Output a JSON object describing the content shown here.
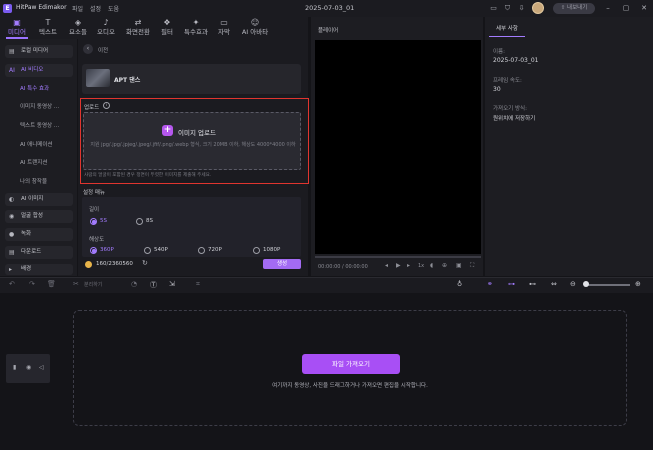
{
  "app": {
    "name": "HitPaw Edimakor",
    "logo": "E"
  },
  "menu": [
    "파일",
    "설정",
    "도움"
  ],
  "document_title": "2025-07-03_01",
  "vip_button": "내보내기",
  "toolbar_tabs": [
    {
      "icon": "media-icon",
      "glyph": "▣",
      "label": "미디어"
    },
    {
      "icon": "text-icon",
      "glyph": "T",
      "label": "텍스트"
    },
    {
      "icon": "elements-icon",
      "glyph": "◈",
      "label": "요소들"
    },
    {
      "icon": "audio-icon",
      "glyph": "♪",
      "label": "오디오"
    },
    {
      "icon": "transition-icon",
      "glyph": "⇄",
      "label": "화면전환"
    },
    {
      "icon": "filter-icon",
      "glyph": "❖",
      "label": "필터"
    },
    {
      "icon": "effects-icon",
      "glyph": "✦",
      "label": "특수효과"
    },
    {
      "icon": "subtitle-icon",
      "glyph": "▭",
      "label": "자막"
    },
    {
      "icon": "avatar-icon",
      "glyph": "☺",
      "label": "AI 아바타"
    }
  ],
  "sidebar": {
    "items": [
      {
        "label": "로컬 미디어",
        "glyph": "▤"
      },
      {
        "label": "AI 비디오",
        "glyph": "AI",
        "active": true
      },
      {
        "label": "AI 이미지",
        "glyph": "◐"
      },
      {
        "label": "얼굴 합성",
        "glyph": "◉"
      },
      {
        "label": "녹화",
        "glyph": "●"
      },
      {
        "label": "다운로드",
        "glyph": "▤"
      },
      {
        "label": "배경",
        "glyph": "▸"
      }
    ],
    "subitems": [
      {
        "label": "AI 특수 효과",
        "active": true
      },
      {
        "label": "이미지 동영상 ..."
      },
      {
        "label": "텍스트 동영상 ..."
      },
      {
        "label": "AI 애니메이션"
      },
      {
        "label": "AI 트랜지션"
      },
      {
        "label": "나의 창작물"
      }
    ]
  },
  "panel": {
    "back_label": "이전",
    "style_name": "APT 댄스",
    "upload_label": "업로드",
    "upload_button": "이미지 업로드",
    "upload_hint": "지원 jpg/.jpg/.jpjeg/.jpeg/.jfif/.png/.webp 형식, 크기 20MB 이하, 해상도 4000*4000 이하",
    "upload_note": "사람의 얼굴이 포함된 경우 정면이 뚜렷한 이미지를 제출해 주세요.",
    "settings_title": "설정 매뉴",
    "length_label": "길이",
    "length_options": [
      {
        "label": "5S",
        "selected": true
      },
      {
        "label": "8S",
        "selected": false
      }
    ],
    "resolution_label": "해상도",
    "resolution_options": [
      {
        "label": "360P",
        "selected": true
      },
      {
        "label": "540P",
        "selected": false
      },
      {
        "label": "720P",
        "selected": false
      },
      {
        "label": "1080P",
        "selected": false
      }
    ],
    "credits": "160/2360560",
    "generate_button": "생성"
  },
  "player": {
    "title": "플레이어",
    "time": "00:00:00 / 00:00:00",
    "speed": "1x",
    "progress": 0
  },
  "details": {
    "tab": "세부 사항",
    "fields": [
      {
        "label": "이름:",
        "value": "2025-07-03_01"
      },
      {
        "label": "프레임 속도:",
        "value": "30"
      },
      {
        "label": "가져오기 방식:",
        "value": "원위치에 저장하기"
      }
    ]
  },
  "timeline": {
    "import_button": "파일 가져오기",
    "hint": "여기까지 동영상, 사진을 드래그하거나 가져오면 편집을 시작합니다.",
    "split_label": "분리하기"
  },
  "colors": {
    "accent": "#a37cff",
    "import_button": "#a84ff5",
    "upload_highlight": "#e0352f",
    "background": "#141418"
  }
}
